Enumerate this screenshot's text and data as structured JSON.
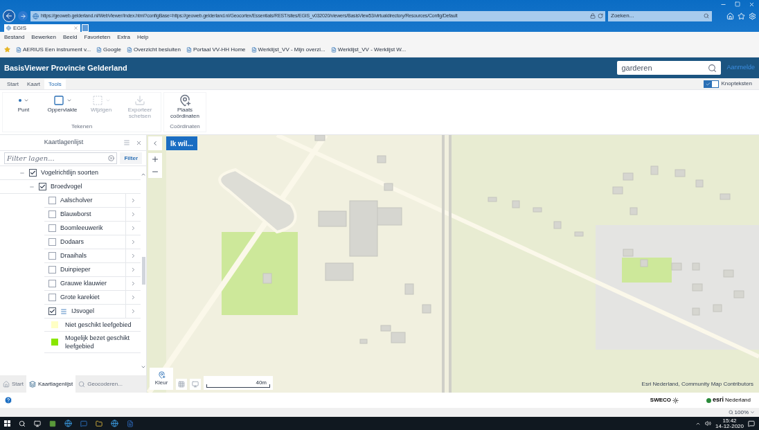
{
  "browser": {
    "url": "https://geoweb.gelderland.nl/WebViewer/Index.html?configBase=https://geoweb.gelderland.nl/Geocortex/Essentials/REST/sites/EGIS_v032020/viewers/BasisView53/virtualdirectory/Resources/Config/Default",
    "search_placeholder": "Zoeken...",
    "tab": {
      "title": "EGIS"
    },
    "menu": [
      "Bestand",
      "Bewerken",
      "Beeld",
      "Favorieten",
      "Extra",
      "Help"
    ],
    "favorites": [
      "AERIUS Een instrument v...",
      "Google",
      "Overzicht besluiten",
      "Portaal VV-HH Home",
      "Werklijst_VV - Mijn overzi...",
      "Werklijst_VV - Werklijst W..."
    ]
  },
  "app": {
    "title": "BasisViewer Provincie Gelderland",
    "search": {
      "value": "garderen"
    },
    "login": "Aanmelde"
  },
  "ribbon": {
    "tabs": [
      {
        "label": "Start",
        "selected": false
      },
      {
        "label": "Kaart",
        "selected": false
      },
      {
        "label": "Tools",
        "selected": true
      }
    ],
    "toggle": {
      "label": "Knopteksten",
      "checked": true
    },
    "groups": [
      {
        "title": "Tekenen",
        "tools": [
          {
            "kind": "point",
            "label": "Punt",
            "dropdown": true,
            "disabled": false
          },
          {
            "kind": "area",
            "label": "Oppervlakte",
            "dropdown": true,
            "disabled": false
          },
          {
            "kind": "edit",
            "label": "Wijzigen",
            "dropdown": true,
            "disabled": true
          },
          {
            "kind": "export",
            "label": "Exporteer schetsen",
            "dropdown": false,
            "disabled": true
          }
        ]
      },
      {
        "title": "Coördinaten",
        "tools": [
          {
            "kind": "pin",
            "label": "Plaats coördinaten",
            "dropdown": false,
            "disabled": false
          }
        ]
      }
    ]
  },
  "panel": {
    "title": "Kaartlagenlijst",
    "filter": {
      "placeholder": "Filter lagen...",
      "button": "Filter"
    },
    "layers": [
      {
        "label": "Vogelrichtlijn soorten",
        "checked": true,
        "expanded": true,
        "children": [
          {
            "label": "Broedvogel",
            "checked": true,
            "expanded": true,
            "children": [
              {
                "label": "Aalscholver",
                "checked": false
              },
              {
                "label": "Blauwborst",
                "checked": false
              },
              {
                "label": "Boomleeuwerik",
                "checked": false
              },
              {
                "label": "Dodaars",
                "checked": false
              },
              {
                "label": "Draaihals",
                "checked": false
              },
              {
                "label": "Duinpieper",
                "checked": false
              },
              {
                "label": "Grauwe klauwier",
                "checked": false
              },
              {
                "label": "Grote karekiet",
                "checked": false
              },
              {
                "label": "IJsvogel",
                "checked": true,
                "legend": [
                  {
                    "label": "Niet geschikt leefgebied",
                    "color": "#ffffc4"
                  },
                  {
                    "label": "Mogelijk bezet geschikt leefgebied",
                    "color": "#8ae600"
                  }
                ]
              }
            ]
          }
        ]
      }
    ],
    "tabs": [
      {
        "label": "Start",
        "selected": false
      },
      {
        "label": "Kaartlagenlijst",
        "selected": true
      },
      {
        "label": "Geocoderen...",
        "selected": false
      }
    ]
  },
  "map": {
    "action_button": "Ik wil...",
    "color_button": "Kleur",
    "scale": "40m",
    "attribution": "Esri Nederland, Community Map Contributors"
  },
  "footer": {
    "logo_sweco": "SWECO",
    "logo_esri": "esri",
    "logo_esri_sub": "Nederland",
    "zoom": "100%"
  },
  "taskbar": {
    "time": "15:42",
    "date": "14-12-2020"
  }
}
